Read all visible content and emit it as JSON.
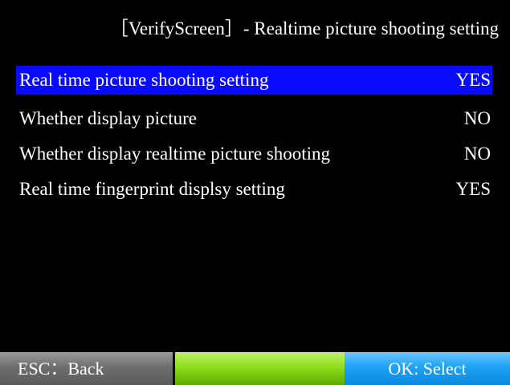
{
  "screen": {
    "title": "［VerifyScreen］- Realtime picture shooting setting"
  },
  "menu": {
    "items": [
      {
        "label": "Real time picture shooting setting",
        "value": "YES",
        "selected": true
      },
      {
        "label": "Whether display picture",
        "value": "NO",
        "selected": false
      },
      {
        "label": "Whether display realtime picture shooting",
        "value": "NO",
        "selected": false
      },
      {
        "label": "Real time fingerprint displsy setting",
        "value": "YES",
        "selected": false
      }
    ]
  },
  "footer": {
    "esc_label": "ESC：Back",
    "middle_label": "",
    "ok_label": "OK: Select"
  },
  "colors": {
    "background": "#000000",
    "selection": "#0a0aff",
    "text": "#ffffff",
    "esc_button": "#6e6e6e",
    "middle_button": "#8ede1c",
    "ok_button": "#1ea3f5"
  }
}
